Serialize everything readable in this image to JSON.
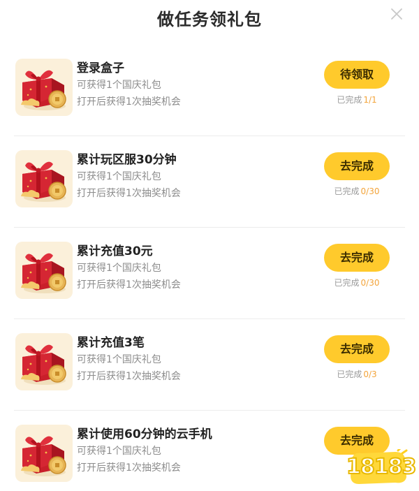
{
  "dialog": {
    "title": "做任务领礼包",
    "close_icon": "close-icon"
  },
  "colors": {
    "button": "#ffca2c",
    "progress_value": "#f3a43a",
    "thumb_bg": "#fbf0da",
    "gift_red": "#c91f2a"
  },
  "tasks": [
    {
      "name": "登录盒子",
      "reward": "可获得1个国庆礼包",
      "chance": "打开后获得1次抽奖机会",
      "button": "待领取",
      "progress_label": "已完成",
      "progress_value": "1/1",
      "icon": "gift-box-icon"
    },
    {
      "name": "累计玩区服30分钟",
      "reward": "可获得1个国庆礼包",
      "chance": "打开后获得1次抽奖机会",
      "button": "去完成",
      "progress_label": "已完成",
      "progress_value": "0/30",
      "icon": "gift-box-icon"
    },
    {
      "name": "累计充值30元",
      "reward": "可获得1个国庆礼包",
      "chance": "打开后获得1次抽奖机会",
      "button": "去完成",
      "progress_label": "已完成",
      "progress_value": "0/30",
      "icon": "gift-box-icon"
    },
    {
      "name": "累计充值3笔",
      "reward": "可获得1个国庆礼包",
      "chance": "打开后获得1次抽奖机会",
      "button": "去完成",
      "progress_label": "已完成",
      "progress_value": "0/3",
      "icon": "gift-box-icon"
    },
    {
      "name": "累计使用60分钟的云手机",
      "reward": "可获得1个国庆礼包",
      "chance": "打开后获得1次抽奖机会",
      "button": "去完成",
      "progress_label": "",
      "progress_value": "",
      "icon": "gift-box-icon"
    }
  ],
  "watermark": {
    "text": "18183"
  }
}
